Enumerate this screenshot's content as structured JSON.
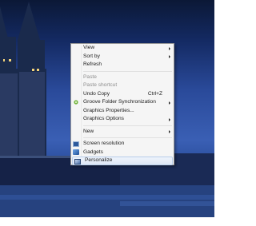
{
  "context_menu": {
    "items": [
      {
        "label": "View",
        "submenu": true
      },
      {
        "label": "Sort by",
        "submenu": true
      },
      {
        "label": "Refresh"
      },
      {
        "label": "Paste",
        "disabled": true
      },
      {
        "label": "Paste shortcut",
        "disabled": true
      },
      {
        "label": "Undo Copy",
        "shortcut": "Ctrl+Z"
      },
      {
        "label": "Groove Folder Synchronization",
        "submenu": true,
        "icon": "groove-icon"
      },
      {
        "label": "Graphics Properties..."
      },
      {
        "label": "Graphics Options",
        "submenu": true
      },
      {
        "label": "New",
        "submenu": true
      },
      {
        "label": "Screen resolution",
        "icon": "screen-resolution-icon"
      },
      {
        "label": "Gadgets",
        "icon": "gadgets-icon"
      },
      {
        "label": "Personalize",
        "icon": "personalize-icon",
        "highlighted": true
      }
    ]
  },
  "colors": {
    "menu_background": "#f5f5f5",
    "highlight": "#dde7f6",
    "disabled_text": "#8d8d8d"
  }
}
